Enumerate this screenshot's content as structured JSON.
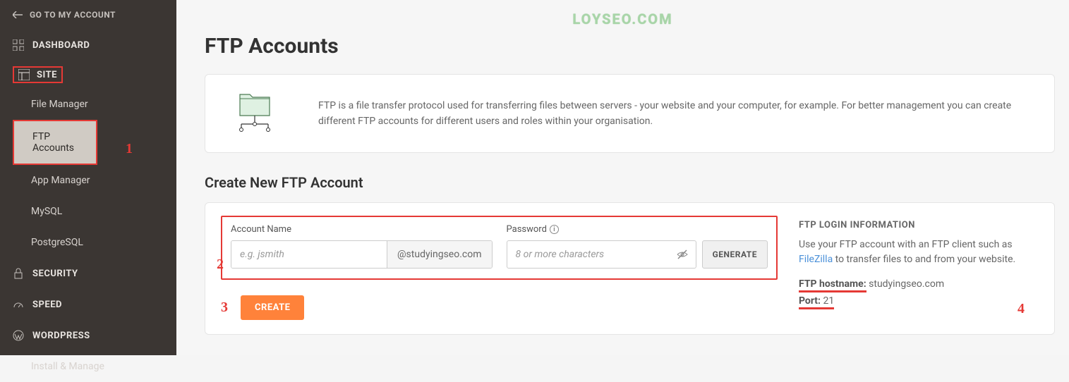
{
  "watermark": "LOYSEO.COM",
  "sidebar": {
    "back_label": "GO TO MY ACCOUNT",
    "sections": {
      "dashboard": "DASHBOARD",
      "site": "SITE",
      "security": "SECURITY",
      "speed": "SPEED",
      "wordpress": "WORDPRESS"
    },
    "site_items": {
      "file_manager": "File Manager",
      "ftp_accounts": "FTP Accounts",
      "app_manager": "App Manager",
      "mysql": "MySQL",
      "postgresql": "PostgreSQL"
    },
    "wp_items": {
      "install_manage": "Install & Manage"
    }
  },
  "page": {
    "title": "FTP Accounts",
    "description": "FTP is a file transfer protocol used for transferring files between servers - your website and your computer, for example. For better management you can create different FTP accounts for different users and roles within your organisation.",
    "create_title": "Create New FTP Account"
  },
  "form": {
    "account_label": "Account Name",
    "account_placeholder": "e.g. jsmith",
    "account_suffix": "@studyingseo.com",
    "password_label": "Password",
    "password_placeholder": "8 or more characters",
    "generate_label": "GENERATE",
    "create_label": "CREATE"
  },
  "login_info": {
    "title": "FTP LOGIN INFORMATION",
    "text_prefix": "Use your FTP account with an FTP client such as ",
    "link": "FileZilla",
    "text_suffix": " to transfer files to and from your website.",
    "hostname_label": "FTP hostname:",
    "hostname_value": "studyingseo.com",
    "port_label": "Port:",
    "port_value": "21"
  },
  "annotations": {
    "a1": "1",
    "a2": "2",
    "a3": "3",
    "a4": "4"
  }
}
